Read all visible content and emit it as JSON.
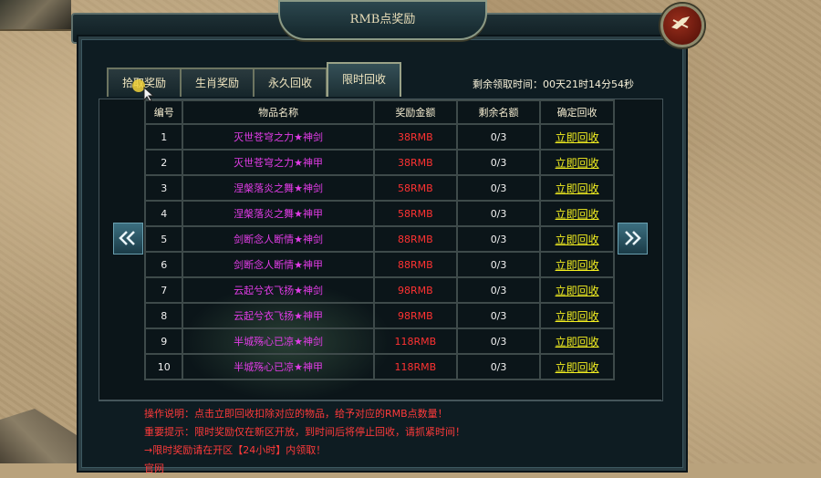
{
  "window": {
    "title": "RMB点奖励"
  },
  "tabs": [
    {
      "label": "拾取奖励",
      "active": false
    },
    {
      "label": "生肖奖励",
      "active": false
    },
    {
      "label": "永久回收",
      "active": false
    },
    {
      "label": "限时回收",
      "active": true
    }
  ],
  "remaining_time": "剩余领取时间：00天21时14分54秒",
  "table": {
    "headers": [
      "编号",
      "物品名称",
      "奖励金额",
      "剩余名额",
      "确定回收"
    ],
    "rows": [
      {
        "no": "1",
        "name": "灭世苍穹之力★神剑",
        "amount": "38RMB",
        "left": "0/3",
        "action": "立即回收"
      },
      {
        "no": "2",
        "name": "灭世苍穹之力★神甲",
        "amount": "38RMB",
        "left": "0/3",
        "action": "立即回收"
      },
      {
        "no": "3",
        "name": "涅槃落炎之舞★神剑",
        "amount": "58RMB",
        "left": "0/3",
        "action": "立即回收"
      },
      {
        "no": "4",
        "name": "涅槃落炎之舞★神甲",
        "amount": "58RMB",
        "left": "0/3",
        "action": "立即回收"
      },
      {
        "no": "5",
        "name": "剑断念人断情★神剑",
        "amount": "88RMB",
        "left": "0/3",
        "action": "立即回收"
      },
      {
        "no": "6",
        "name": "剑断念人断情★神甲",
        "amount": "88RMB",
        "left": "0/3",
        "action": "立即回收"
      },
      {
        "no": "7",
        "name": "云起兮衣飞扬★神剑",
        "amount": "98RMB",
        "left": "0/3",
        "action": "立即回收"
      },
      {
        "no": "8",
        "name": "云起兮衣飞扬★神甲",
        "amount": "98RMB",
        "left": "0/3",
        "action": "立即回收"
      },
      {
        "no": "9",
        "name": "半城殇心已凉★神剑",
        "amount": "118RMB",
        "left": "0/3",
        "action": "立即回收"
      },
      {
        "no": "10",
        "name": "半城殇心已凉★神甲",
        "amount": "118RMB",
        "left": "0/3",
        "action": "立即回收"
      }
    ]
  },
  "notes": {
    "line1": "操作说明：点击立即回收扣除对应的物品，给予对应的RMB点数量！",
    "line2": "重要提示：限时奖励仅在新区开放，到时间后将停止回收，请抓紧时间！",
    "line3": "→限时奖励请在开区【24小时】内领取！",
    "line4": "官网"
  },
  "icons": {
    "close": "close-icon",
    "prev": "chevron-left-double-icon",
    "next": "chevron-right-double-icon"
  },
  "colors": {
    "item_name": "#e23ce7",
    "amount": "#ff3232",
    "action": "#f4f020",
    "notes": "#ff3a3a"
  }
}
